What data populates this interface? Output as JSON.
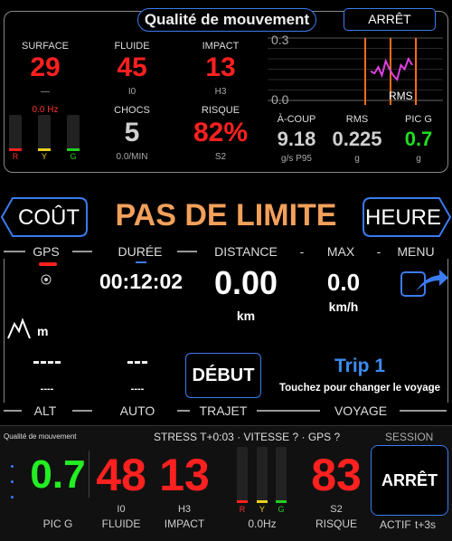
{
  "header": {
    "title": "Qualité de mouvement",
    "stop_label": "ARRÊT"
  },
  "metrics": {
    "surface": {
      "label": "SURFACE",
      "value": "29",
      "sub": "—",
      "freq": "0.0 Hz"
    },
    "fluide": {
      "label": "FLUIDE",
      "value": "45",
      "sub": "I0"
    },
    "impact": {
      "label": "IMPACT",
      "value": "13",
      "sub": "H3"
    },
    "chocs": {
      "label": "CHOCS",
      "value": "5",
      "sub": "0.0/MIN"
    },
    "risque": {
      "label": "RISQUE",
      "value": "82%",
      "sub": "S2"
    }
  },
  "meters_top": {
    "labels": [
      "R",
      "Y",
      "G"
    ]
  },
  "chart_data": {
    "type": "line",
    "y_ticks": [
      "0.3",
      "0.0"
    ],
    "series_label": "RMS",
    "values": [
      0.14,
      0.13,
      0.16,
      0.12,
      0.19,
      0.15,
      0.12,
      0.1,
      0.17,
      0.15,
      0.2,
      0.17
    ],
    "ylim": [
      0,
      0.3
    ],
    "colors": {
      "line": "#e040e0",
      "markers": "#ff6a1a",
      "grid": "#555"
    }
  },
  "stats": {
    "acoup": {
      "label": "À-COUP",
      "value": "9.18",
      "unit": "g/s P95"
    },
    "rms": {
      "label": "RMS",
      "value": "0.225",
      "unit": "g"
    },
    "pic_g": {
      "label": "PIC G",
      "value": "0.7",
      "unit": "g"
    }
  },
  "nav": {
    "cost_label": "COÛT",
    "limit_text": "PAS DE LIMITE",
    "hour_label": "HEURE"
  },
  "tabs": {
    "gps": "GPS",
    "duree": "DURÉE",
    "distance": "DISTANCE",
    "max": "MAX",
    "menu": "MENU",
    "dash": "-",
    "dash2": "-"
  },
  "trip": {
    "duration": "00:12:02",
    "distance_value": "0.00",
    "distance_unit": "km",
    "speed_value": "0.0",
    "speed_unit": "km/h",
    "elev_unit": "m",
    "alt_value": "----",
    "alt_sub": "----",
    "auto_value": "---",
    "auto_sub": "----",
    "start_label": "DÉBUT",
    "trip_name": "Trip 1",
    "trip_hint": "Touchez pour changer le voyage"
  },
  "bottom_tabs": {
    "alt": "ALT",
    "auto": "AUTO",
    "trajet": "TRAJET",
    "voyage": "VOYAGE"
  },
  "footer": {
    "title": "Qualité de mouvement",
    "status": "STRESS T+0:03 · VITESSE ? · GPS ?",
    "session": "SESSION",
    "pic_g_value": "0.7",
    "pic_g_label": "PIC G",
    "fluide_value": "48",
    "fluide_sub": "I0",
    "fluide_label": "FLUIDE",
    "impact_value": "13",
    "impact_sub": "H3",
    "impact_label": "IMPACT",
    "hz_label": "0.0Hz",
    "risque_value": "83",
    "risque_sub": "S2",
    "risque_label": "RISQUE",
    "stop_label": "ARRÊT",
    "actif": "ACTIF",
    "actif_time": "t+3s",
    "meter_labels": [
      "R",
      "Y",
      "G"
    ]
  }
}
